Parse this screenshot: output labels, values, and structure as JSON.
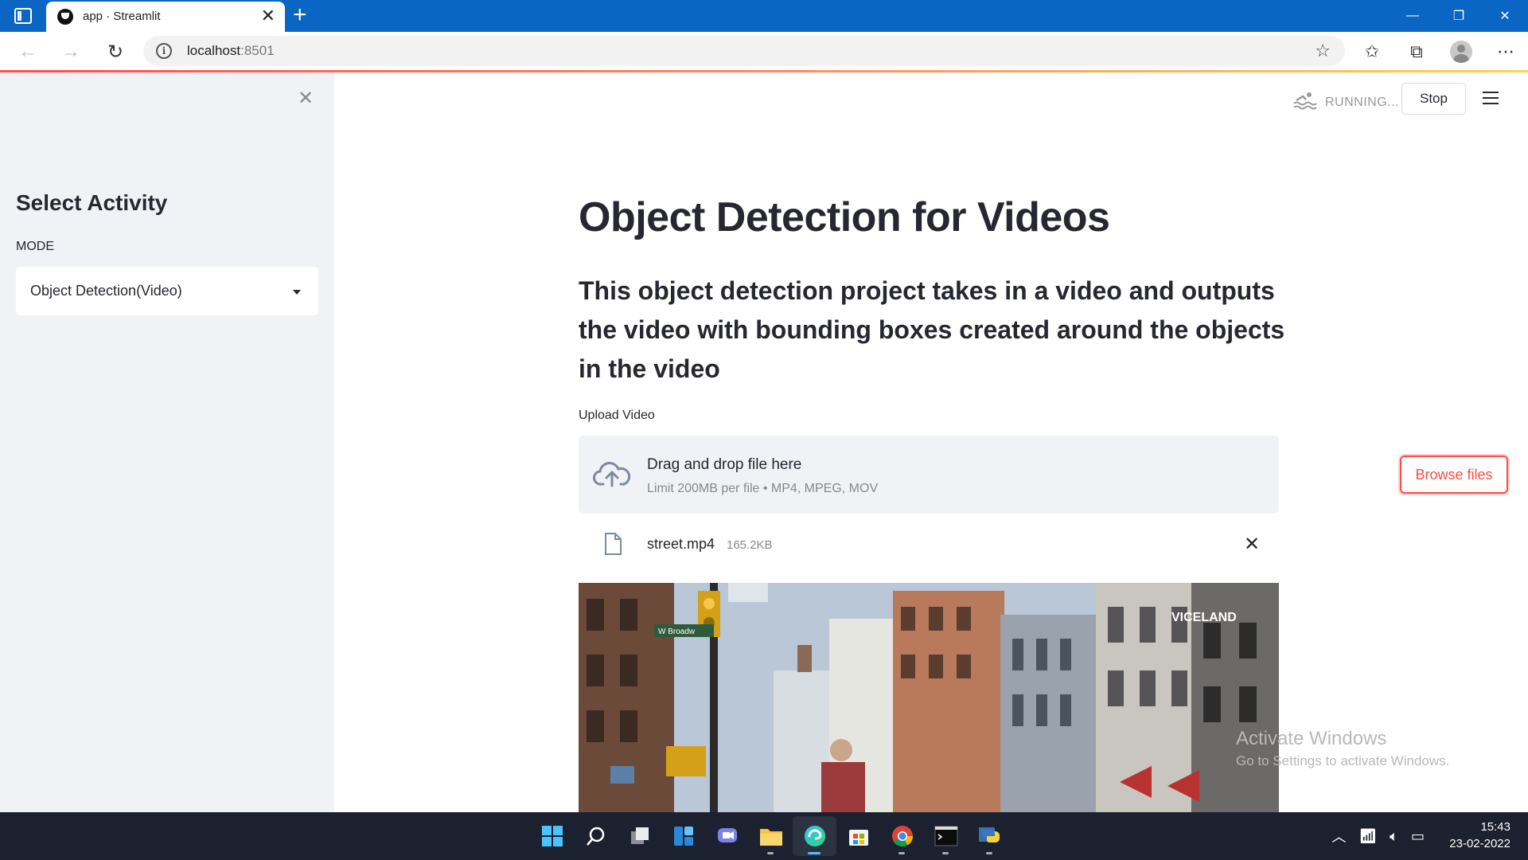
{
  "browser": {
    "tab_title": "app · Streamlit",
    "tab_close": "✕",
    "new_tab": "+",
    "address_host": "localhost",
    "address_port": ":8501",
    "window_controls": [
      "—",
      "❐",
      "✕"
    ]
  },
  "sidebar": {
    "close_glyph": "✕",
    "heading": "Select Activity",
    "mode_label": "MODE",
    "mode_value": "Object Detection(Video)"
  },
  "header": {
    "status_text": "RUNNING...",
    "stop_label": "Stop"
  },
  "main": {
    "title": "Object Detection for Videos",
    "subtitle": "This object detection project takes in a video and outputs the video with bounding boxes created around the objects in the video",
    "upload_label": "Upload Video",
    "dropzone_title": "Drag and drop file here",
    "dropzone_limit": "Limit 200MB per file • MP4, MPEG, MOV",
    "browse_label": "Browse files",
    "file_name": "street.mp4",
    "file_size": "165.2KB",
    "video_overlay_text": "VICELAND",
    "street_sign_text": "W Broadw"
  },
  "watermark": {
    "line1": "Activate Windows",
    "line2": "Go to Settings to activate Windows."
  },
  "taskbar": {
    "time": "15:43",
    "date": "23-02-2022"
  },
  "colors": {
    "accent": "#ff4b4b",
    "sidebar_bg": "#f0f2f6",
    "titlebar": "#0b66c3",
    "taskbar": "#1c2130"
  }
}
